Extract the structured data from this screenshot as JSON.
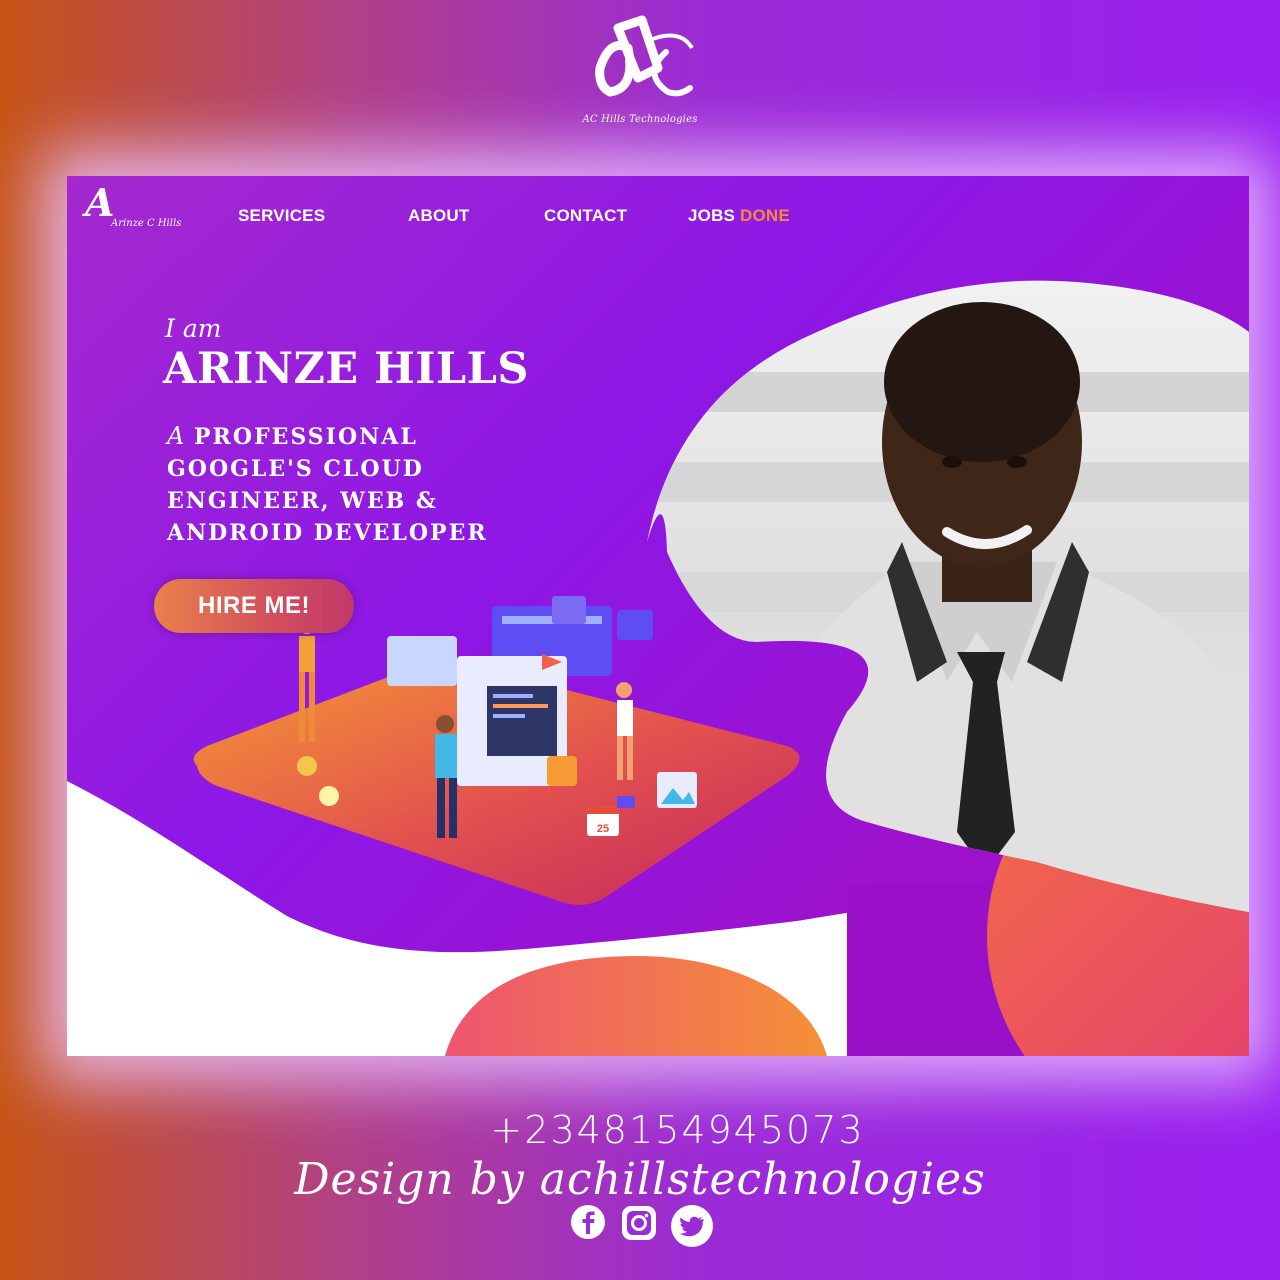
{
  "brand": {
    "name": "AC Hills Technologies"
  },
  "site": {
    "logo_letter": "A",
    "logo_text": "Arinze C Hills",
    "nav": {
      "services": "SERVICES",
      "about": "ABOUT",
      "contact": "CONTACT",
      "jobs_word1": "JOBS",
      "jobs_word2": "DONE"
    },
    "hero": {
      "intro": "I am",
      "name": "ARINZE HILLS",
      "tag_prefix": "A",
      "tag_line1": "PROFESSIONAL",
      "tag_line2": "GOOGLE'S CLOUD",
      "tag_line3": "ENGINEER, WEB &",
      "tag_line4": "ANDROID DEVELOPER",
      "cta": "HIRE ME!"
    },
    "illustration": {
      "calendar_day": "25"
    }
  },
  "footer": {
    "phone": "+2348154945073",
    "credit": "Design by achillstechnologies",
    "social_icons": [
      "facebook-icon",
      "instagram-icon",
      "twitter-icon"
    ]
  },
  "colors": {
    "accent_orange": "#f38a3a",
    "hero_purple": "#8d17e6",
    "cta_gradient_start": "#e9814a",
    "cta_gradient_end": "#c1386a"
  }
}
